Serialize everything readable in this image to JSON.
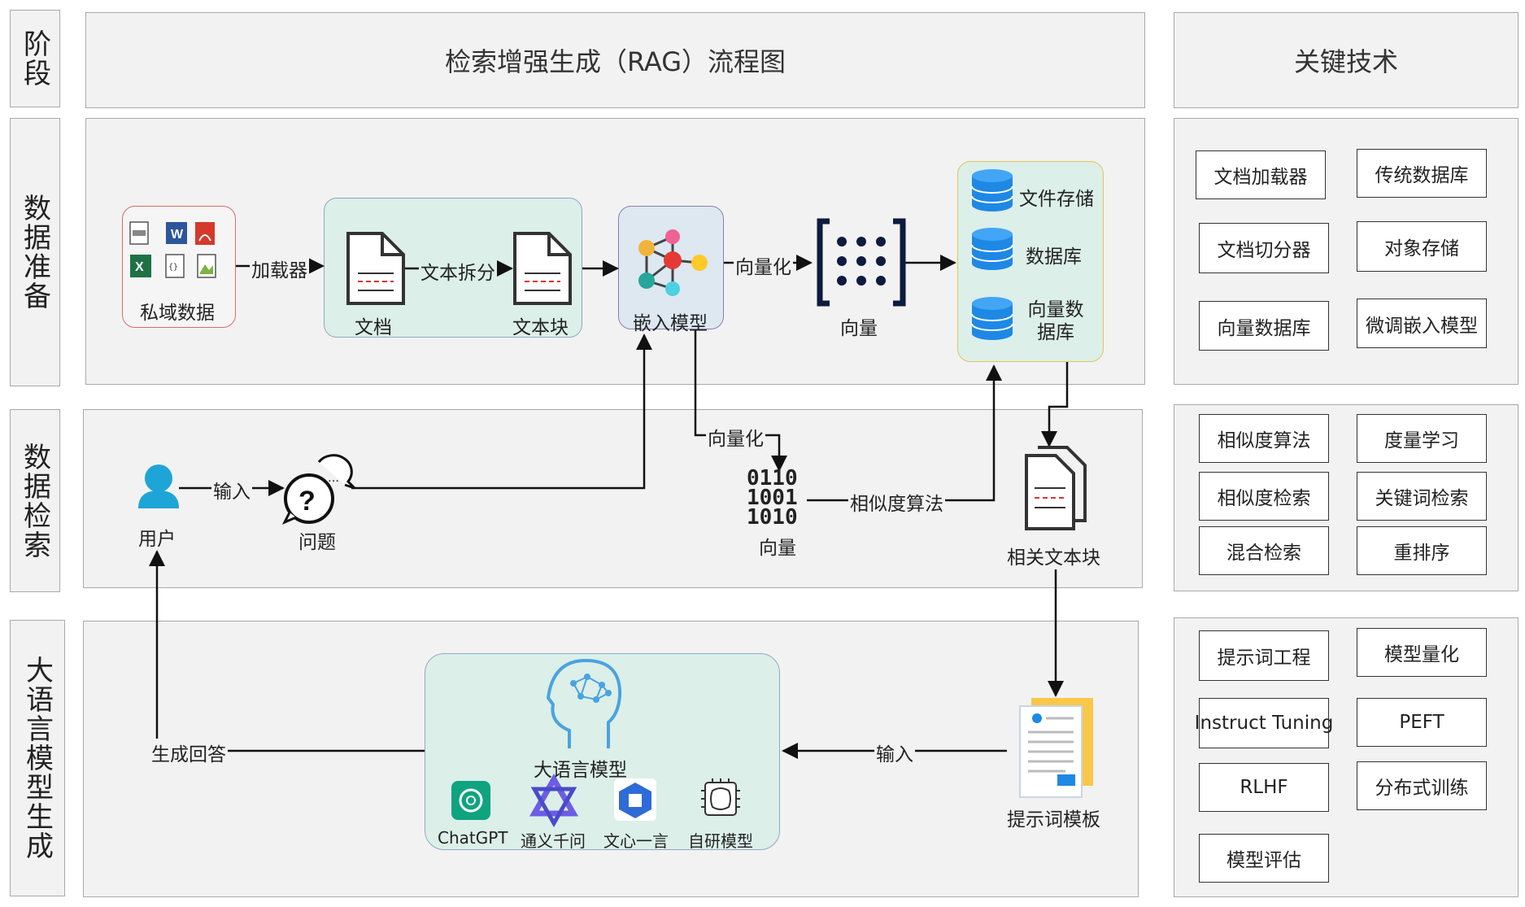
{
  "stages": {
    "phase": "阶段",
    "prep": "数据准备",
    "retrieval": "数据检索",
    "generation": "大语言模型生成"
  },
  "title": "检索增强生成（RAG）流程图",
  "key_tech_title": "关键技术",
  "prep": {
    "private_data": "私域数据",
    "loader": "加载器",
    "document": "文档",
    "split": "文本拆分",
    "chunk": "文本块",
    "embed_model": "嵌入模型",
    "vectorize": "向量化",
    "vector": "向量",
    "file_storage": "文件存储",
    "database": "数据库",
    "vector_db": "向量数据库"
  },
  "retrieval": {
    "user": "用户",
    "input": "输入",
    "question": "问题",
    "vectorize": "向量化",
    "binary": [
      "0110",
      "1001",
      "1010"
    ],
    "vector": "向量",
    "similarity": "相似度算法",
    "relevant_chunks": "相关文本块"
  },
  "generation": {
    "generate_answer": "生成回答",
    "llm": "大语言模型",
    "input": "输入",
    "prompt_template": "提示词模板",
    "models": [
      "ChatGPT",
      "通义千问",
      "文心一言",
      "自研模型"
    ]
  },
  "key_tech": {
    "group1": [
      "文档加载器",
      "传统数据库",
      "文档切分器",
      "对象存储",
      "向量数据库",
      "微调嵌入模型"
    ],
    "group2": [
      "相似度算法",
      "度量学习",
      "相似度检索",
      "关键词检索",
      "混合检索",
      "重排序"
    ],
    "group3": [
      "提示词工程",
      "模型量化",
      "Instruct Tuning",
      "PEFT",
      "RLHF",
      "分布式训练",
      "模型评估"
    ]
  },
  "colors": {
    "panel_bg": "#f2f2f2",
    "teal_box": "#dcefe9",
    "blue_box": "#dde8f1",
    "db_blue": "#1e88e5",
    "icon_dark": "#0d1b3e",
    "chatgpt": "#10a37f"
  },
  "icons": {
    "user": "user-icon",
    "question": "question-chat-icon",
    "brain": "brain-head-icon",
    "document": "document-icon",
    "database": "database-icon",
    "neural": "neural-network-icon"
  }
}
